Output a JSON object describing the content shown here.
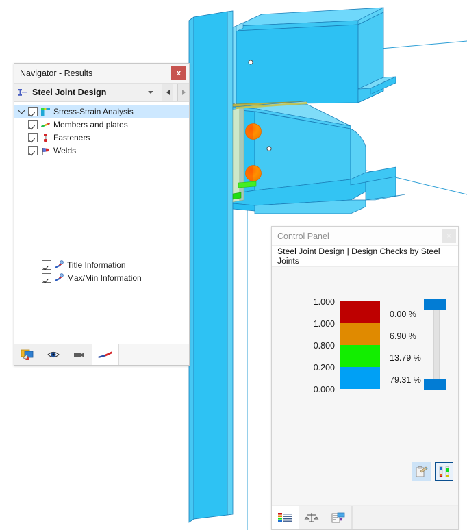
{
  "viewport": {
    "name": "3d-model-viewport",
    "model": "steel-joint-3d-model",
    "member_color": "#1fb6ef",
    "member_color_light": "#5fd0f7",
    "bolt_color": "#ff8c00",
    "weld_color": "#44ee22",
    "edge_color": "#1b7fb8"
  },
  "navigator": {
    "title": "Navigator - Results",
    "close_label": "x",
    "combo": {
      "value": "Steel Joint Design",
      "icon": "steel-joint-icon",
      "prev_label": "◀",
      "next_label": "▶"
    },
    "tree": [
      {
        "label": "Stress-Strain Analysis",
        "checked": true,
        "selected": true,
        "expanded": true,
        "level": 0,
        "icon": "stress-strain-icon"
      },
      {
        "label": "Members and plates",
        "checked": true,
        "selected": false,
        "level": 1,
        "icon": "members-plates-icon"
      },
      {
        "label": "Fasteners",
        "checked": true,
        "selected": false,
        "level": 1,
        "icon": "fasteners-icon"
      },
      {
        "label": "Welds",
        "checked": true,
        "selected": false,
        "level": 1,
        "icon": "welds-icon"
      }
    ],
    "tree_bottom": [
      {
        "label": "Title Information",
        "checked": true,
        "icon": "title-information-icon"
      },
      {
        "label": "Max/Min Information",
        "checked": true,
        "icon": "maxmin-information-icon"
      }
    ],
    "toolbar": [
      {
        "name": "display-properties-button",
        "icon": "display-properties-icon",
        "selected": false
      },
      {
        "name": "visibilities-button",
        "icon": "eye-icon",
        "selected": false
      },
      {
        "name": "video-button",
        "icon": "camera-icon",
        "selected": false
      },
      {
        "name": "results-button",
        "icon": "results-arrow-icon",
        "selected": true
      }
    ]
  },
  "control_panel": {
    "title": "Control Panel",
    "close_label": "×",
    "subtitle": "Steel Joint Design | Design Checks by Steel Joints",
    "legend": {
      "values": [
        "1.000",
        "1.000",
        "0.800",
        "0.200",
        "0.000"
      ],
      "bands": [
        {
          "color": "#be0000",
          "percent": "0.00 %"
        },
        {
          "color": "#e08a00",
          "percent": "6.90 %"
        },
        {
          "color": "#12ee00",
          "percent": "13.79 %"
        },
        {
          "color": "#00a0f5",
          "percent": "79.31 %"
        }
      ],
      "slider_color": "#027cd4"
    },
    "right_buttons": [
      {
        "name": "color-scale-edit-button",
        "icon": "palette-edit-icon",
        "active": false
      },
      {
        "name": "color-spectrum-button",
        "icon": "color-spectrum-icon",
        "active": true
      }
    ],
    "tabs": [
      {
        "name": "tab-color-scale",
        "icon": "color-scale-icon",
        "selected": true
      },
      {
        "name": "tab-factors",
        "icon": "scales-icon",
        "selected": false
      },
      {
        "name": "tab-display-filter",
        "icon": "filter-icon",
        "selected": false
      }
    ]
  }
}
